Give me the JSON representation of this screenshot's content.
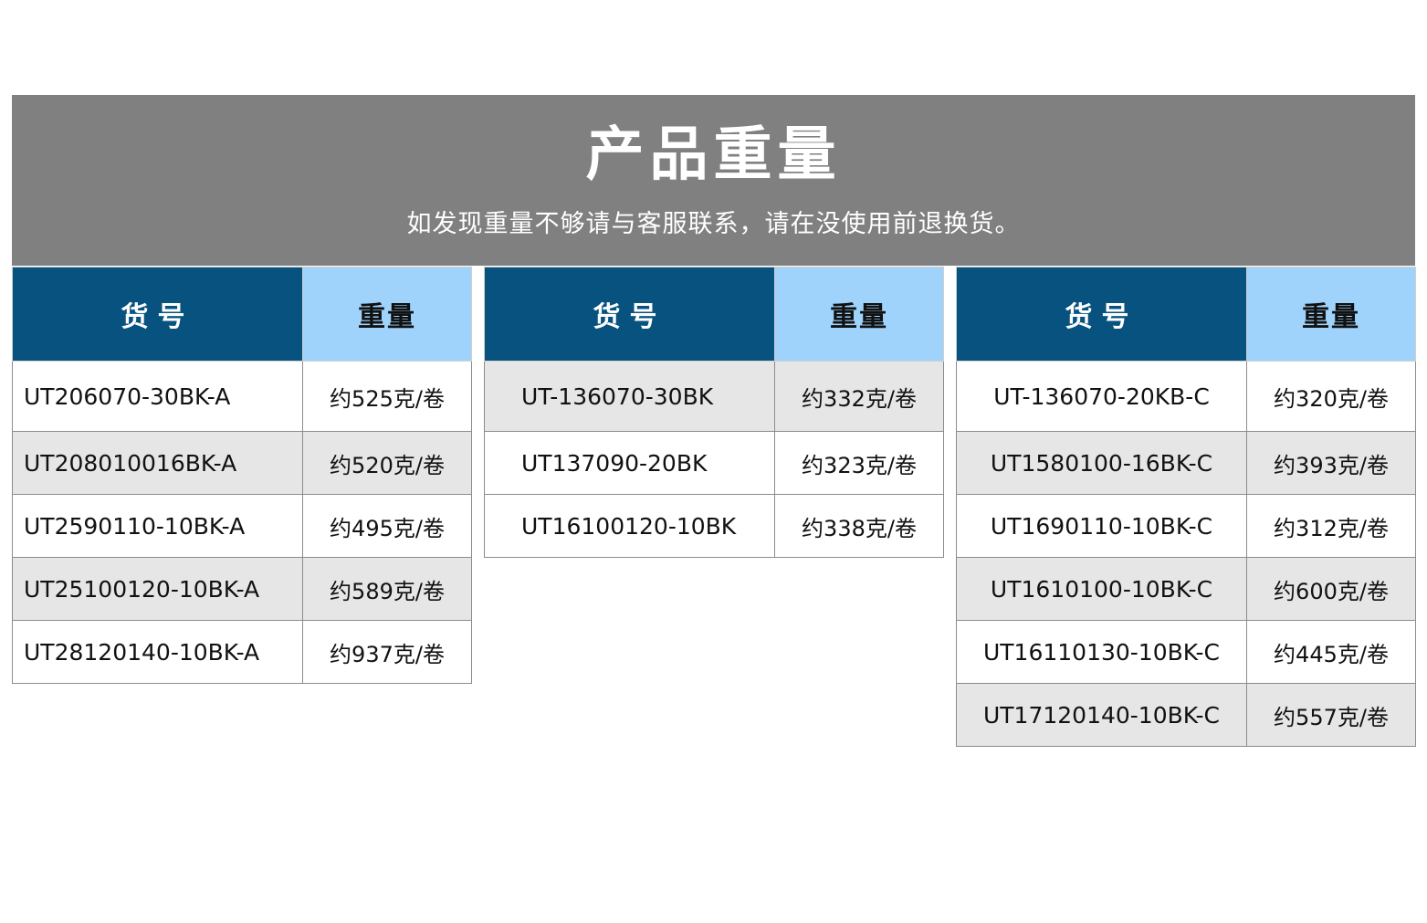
{
  "header": {
    "title": "产品重量",
    "subtitle": "如发现重量不够请与客服联系，请在没使用前退换货。"
  },
  "columns": {
    "id_label": "货号",
    "weight_label": "重量"
  },
  "tables": [
    {
      "rows": [
        {
          "id": "UT206070-30BK-A",
          "weight": "约525克/卷"
        },
        {
          "id": "UT208010016BK-A",
          "weight": "约520克/卷"
        },
        {
          "id": "UT2590110-10BK-A",
          "weight": "约495克/卷"
        },
        {
          "id": "UT25100120-10BK-A",
          "weight": "约589克/卷"
        },
        {
          "id": "UT28120140-10BK-A",
          "weight": "约937克/卷"
        }
      ]
    },
    {
      "rows": [
        {
          "id": "UT-136070-30BK",
          "weight": "约332克/卷"
        },
        {
          "id": "UT137090-20BK",
          "weight": "约323克/卷"
        },
        {
          "id": "UT16100120-10BK",
          "weight": "约338克/卷"
        }
      ]
    },
    {
      "rows": [
        {
          "id": "UT-136070-20KB-C",
          "weight": "约320克/卷"
        },
        {
          "id": "UT1580100-16BK-C",
          "weight": "约393克/卷"
        },
        {
          "id": "UT1690110-10BK-C",
          "weight": "约312克/卷"
        },
        {
          "id": "UT1610100-10BK-C",
          "weight": "约600克/卷"
        },
        {
          "id": "UT16110130-10BK-C",
          "weight": "约445克/卷"
        },
        {
          "id": "UT17120140-10BK-C",
          "weight": "约557克/卷"
        }
      ]
    }
  ],
  "colors": {
    "banner": "#808080",
    "id_header": "#07527f",
    "weight_header": "#9fd3fb",
    "shaded_row": "#e6e6e6"
  }
}
